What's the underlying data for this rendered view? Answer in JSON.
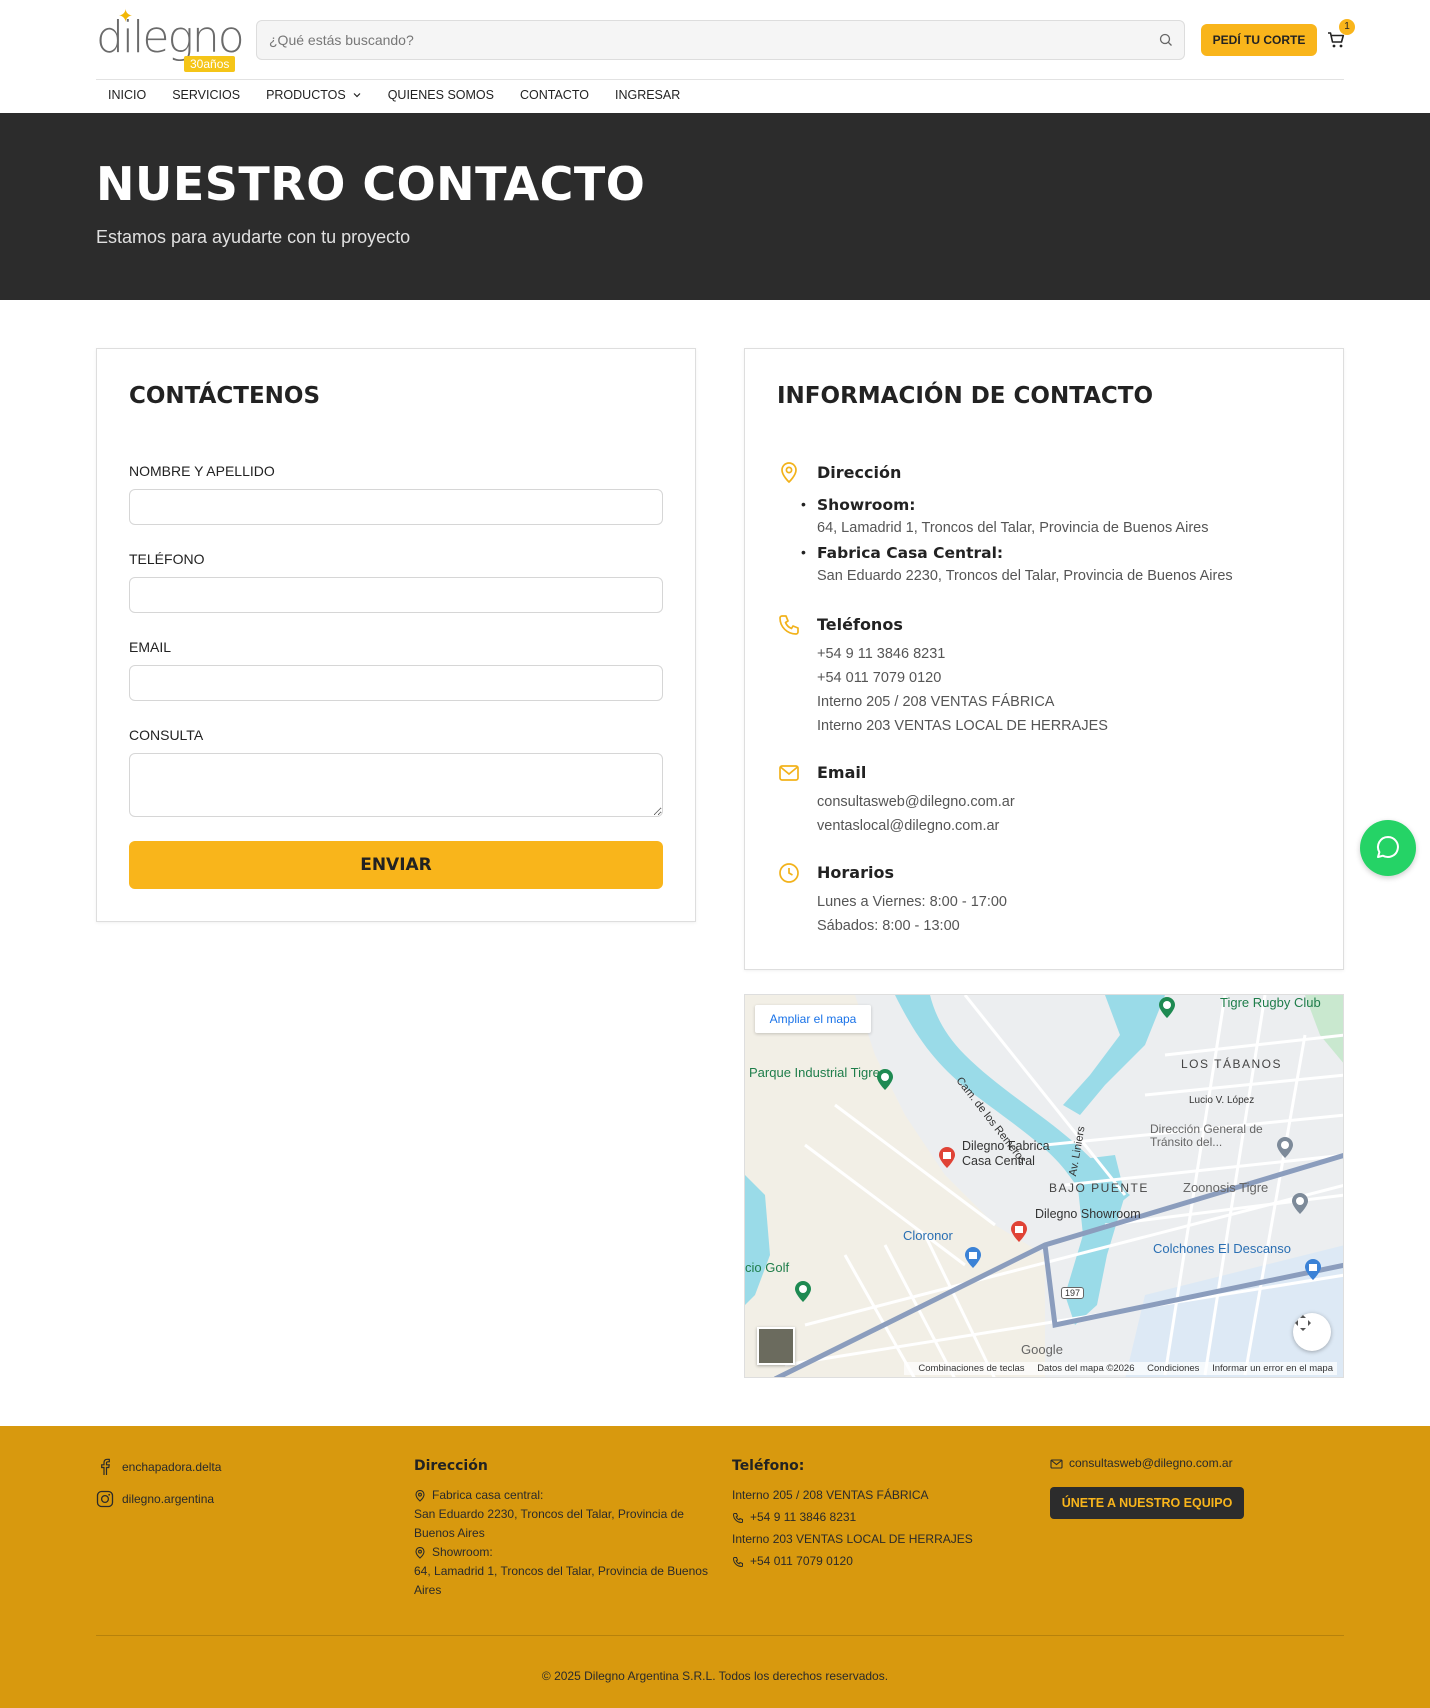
{
  "header": {
    "logo_text": "dilegno",
    "logo_badge": "30años",
    "search_placeholder": "¿Qué estás buscando?",
    "cut_button": "PEDÍ TU CORTE",
    "cart_count": "1"
  },
  "nav": {
    "items": [
      "INICIO",
      "SERVICIOS",
      "PRODUCTOS",
      "QUIENES SOMOS",
      "CONTACTO",
      "INGRESAR"
    ]
  },
  "hero": {
    "title": "NUESTRO CONTACTO",
    "subtitle": "Estamos para ayudarte con tu proyecto"
  },
  "form": {
    "title": "CONTÁCTENOS",
    "name_label": "NOMBRE Y APELLIDO",
    "phone_label": "TELÉFONO",
    "email_label": "EMAIL",
    "query_label": "CONSULTA",
    "submit": "ENVIAR"
  },
  "info": {
    "title": "INFORMACIÓN DE CONTACTO",
    "address_title": "Dirección",
    "showroom_label": "Showroom:",
    "showroom_address": "64, Lamadrid 1, Troncos del Talar, Provincia de Buenos Aires",
    "factory_label": "Fabrica Casa Central:",
    "factory_address": "San Eduardo 2230, Troncos del Talar, Provincia de Buenos Aires",
    "phones_title": "Teléfonos",
    "phones": [
      "+54 9 11 3846 8231",
      "+54 011 7079 0120",
      "Interno 205 / 208 VENTAS FÁBRICA",
      "Interno 203 VENTAS LOCAL DE HERRAJES"
    ],
    "email_title": "Email",
    "emails": [
      "consultasweb@dilegno.com.ar",
      "ventaslocal@dilegno.com.ar"
    ],
    "hours_title": "Horarios",
    "hours": [
      "Lunes a Viernes: 8:00 - 17:00",
      "Sábados: 8:00 - 13:00"
    ]
  },
  "map": {
    "expand_button": "Ampliar el mapa",
    "labels": {
      "parque": "Parque Industrial Tigre",
      "rugby": "Tigre Rugby Club",
      "tabanos": "LOS TÁBANOS",
      "lucio": "Lucio V. López",
      "transito": "Dirección General de Tránsito del...",
      "fabrica": "Dilegno Fabrica Casa Central",
      "bajo": "BAJO PUENTE",
      "zoonosis": "Zoonosis Tigre",
      "showroom": "Dilegno Showroom",
      "cloronor": "Cloronor",
      "colchones": "Colchones El Descanso",
      "golf": "cio Golf",
      "remeros": "Cam. de los Remeros",
      "liniers": "Av. Liniers",
      "route": "197"
    },
    "footer": [
      "Combinaciones de teclas",
      "Datos del mapa ©2026",
      "Condiciones",
      "Informar un error en el mapa"
    ],
    "google": "Google"
  },
  "footer": {
    "facebook": "enchapadora.delta",
    "instagram": "dilegno.argentina",
    "address_title": "Dirección",
    "factory_label": "Fabrica casa central:",
    "factory_address": "San Eduardo 2230, Troncos del Talar, Provincia de Buenos Aires",
    "showroom_label": "Showroom:",
    "showroom_address": "64, Lamadrid 1, Troncos del Talar, Provincia de Buenos Aires",
    "phone_title": "Teléfono:",
    "phone_line1": "Interno 205 / 208 VENTAS FÁBRICA",
    "phone1": "+54 9 11 3846 8231",
    "phone_line2": "Interno 203 VENTAS LOCAL DE HERRAJES",
    "phone2": "+54 011 7079 0120",
    "email": "consultasweb@dilegno.com.ar",
    "join_button": "ÚNETE A NUESTRO EQUIPO",
    "copyright": "© 2025 Dilegno Argentina S.R.L. Todos los derechos reservados."
  },
  "colors": {
    "accent": "#f9b51b",
    "hero_bg": "#2c2c2c",
    "footer_bg": "#d8990e",
    "whatsapp": "#25d366"
  }
}
